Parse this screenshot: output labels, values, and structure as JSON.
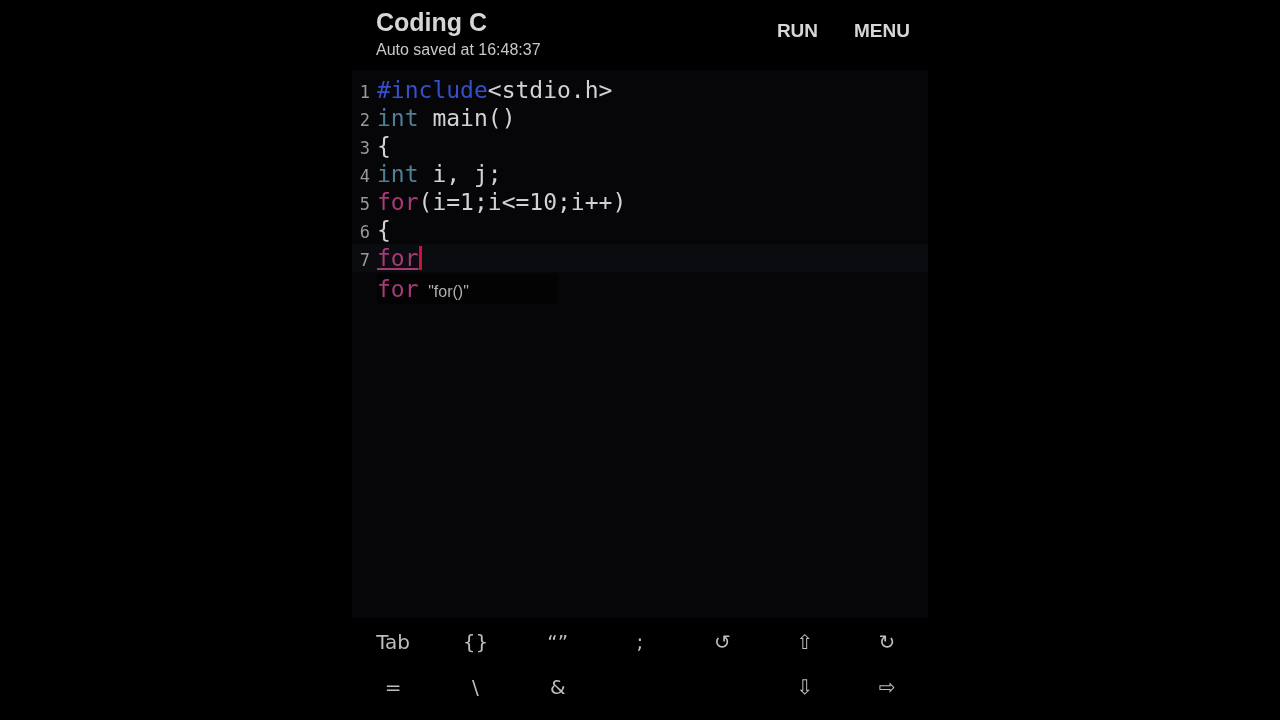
{
  "app_bar": {
    "title": "Coding C",
    "subtitle": "Auto saved at 16:48:37",
    "actions": [
      "RUN",
      "MENU"
    ]
  },
  "editor": {
    "lines": [
      {
        "number": "1",
        "current": false,
        "tokens": [
          {
            "text": "#include",
            "kind": "preprocessor"
          },
          {
            "text": "<stdio.h>",
            "kind": "plain"
          }
        ]
      },
      {
        "number": "2",
        "current": false,
        "tokens": [
          {
            "text": "int",
            "kind": "type"
          },
          {
            "text": " main()",
            "kind": "plain"
          }
        ]
      },
      {
        "number": "3",
        "current": false,
        "tokens": [
          {
            "text": "{",
            "kind": "plain"
          }
        ]
      },
      {
        "number": "4",
        "current": false,
        "tokens": [
          {
            "text": "int",
            "kind": "type"
          },
          {
            "text": " i, j;",
            "kind": "plain"
          }
        ]
      },
      {
        "number": "5",
        "current": false,
        "tokens": [
          {
            "text": "for",
            "kind": "keyword"
          },
          {
            "text": "(i=1;i<=10;i++)",
            "kind": "plain"
          }
        ]
      },
      {
        "number": "6",
        "current": false,
        "tokens": [
          {
            "text": "{",
            "kind": "plain"
          }
        ]
      },
      {
        "number": "7",
        "current": true,
        "tokens": [
          {
            "text": "for",
            "kind": "keyword",
            "composing": true
          }
        ]
      }
    ],
    "suggestion": {
      "word": "for",
      "hint": "\"for()\""
    }
  },
  "keyboard": {
    "rows": [
      [
        {
          "label": "Tab"
        },
        {
          "label": "{}"
        },
        {
          "label": "“”"
        },
        {
          "label": ";"
        },
        {
          "label": "↺"
        },
        {
          "label": "⇧"
        },
        {
          "label": "↻"
        }
      ],
      [
        {
          "label": "="
        },
        {
          "label": "\\"
        },
        {
          "label": "&"
        },
        null,
        null,
        {
          "label": "⇩"
        },
        {
          "label": "⇨"
        }
      ]
    ]
  }
}
